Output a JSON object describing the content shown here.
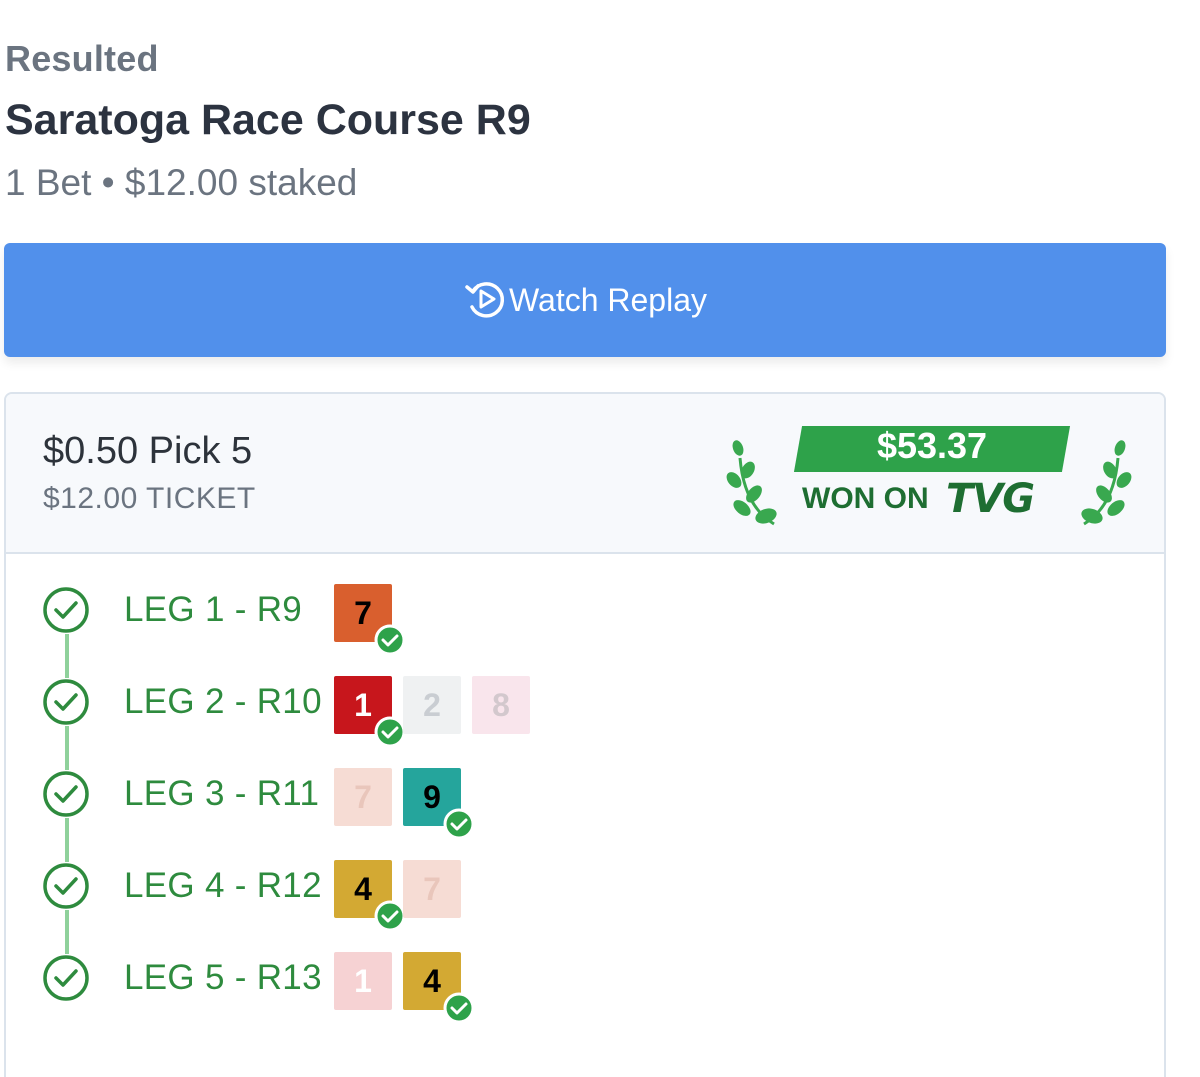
{
  "header": {
    "status": "Resulted",
    "title": "Saratoga Race Course R9",
    "summary": "1 Bet • $12.00 staked"
  },
  "replay_button": {
    "label": "Watch Replay",
    "icon": "replay-play-icon"
  },
  "bet": {
    "name": "$0.50 Pick 5",
    "ticket": "$12.00 TICKET",
    "winnings": "$53.37",
    "won_on": "WON ON",
    "brand": "TVG",
    "brand_color": "#1e6e32",
    "winning_color": "#2ea24a"
  },
  "legs": [
    {
      "label": "LEG 1 - R9",
      "runners": [
        {
          "number": "7",
          "bg": "#d95f2e",
          "fg": "#000000",
          "winner": true
        }
      ]
    },
    {
      "label": "LEG 2 - R10",
      "runners": [
        {
          "number": "1",
          "bg": "#c7161c",
          "fg": "#ffffff",
          "winner": true
        },
        {
          "number": "2",
          "bg": "#eff1f2",
          "fg": "#c9cdd2",
          "winner": false
        },
        {
          "number": "8",
          "bg": "#f9e5ec",
          "fg": "#d3c8cd",
          "winner": false
        }
      ]
    },
    {
      "label": "LEG 3 - R11",
      "runners": [
        {
          "number": "7",
          "bg": "#f6dcd4",
          "fg": "#e9c6bb",
          "winner": false
        },
        {
          "number": "9",
          "bg": "#25a59c",
          "fg": "#000000",
          "winner": true
        }
      ]
    },
    {
      "label": "LEG 4 - R12",
      "runners": [
        {
          "number": "4",
          "bg": "#d3a933",
          "fg": "#000000",
          "winner": true
        },
        {
          "number": "7",
          "bg": "#f6dcd4",
          "fg": "#e9c6bb",
          "winner": false
        }
      ]
    },
    {
      "label": "LEG 5 - R13",
      "runners": [
        {
          "number": "1",
          "bg": "#f6d2d3",
          "fg": "#ffffff",
          "winner": false
        },
        {
          "number": "4",
          "bg": "#d3a933",
          "fg": "#000000",
          "winner": true
        }
      ]
    }
  ]
}
